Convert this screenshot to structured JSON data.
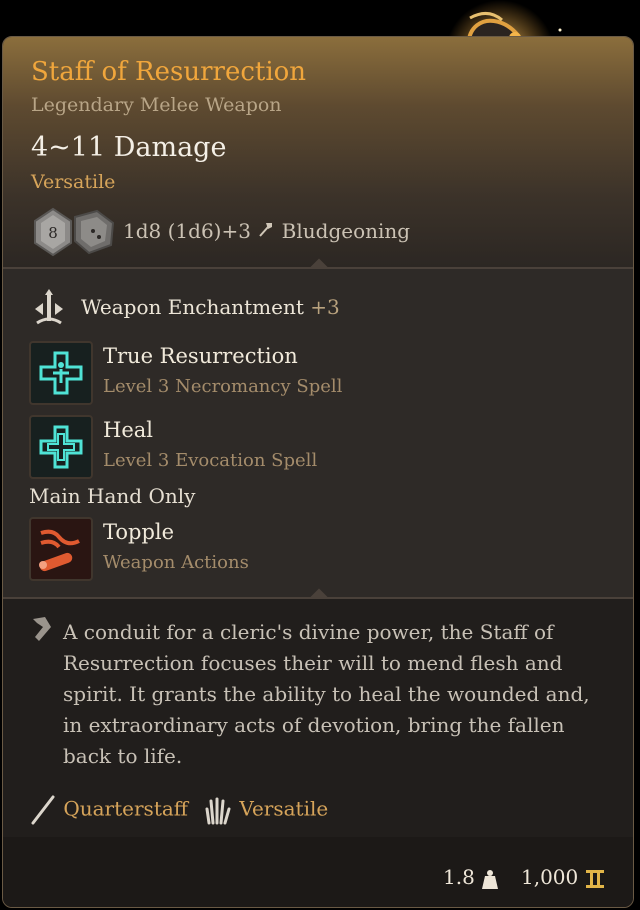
{
  "item": {
    "name": "Staff of Resurrection",
    "rarity_type": "Legendary Melee Weapon",
    "damage": "4~11 Damage",
    "property_tag": "Versatile",
    "dice_face": "8",
    "dice_formula": "1d8 (1d6)+3",
    "damage_type": "Bludgeoning"
  },
  "enchantment": {
    "label": "Weapon Enchantment",
    "bonus": "+3"
  },
  "spells": [
    {
      "name": "True Resurrection",
      "sub": "Level 3 Necromancy Spell"
    },
    {
      "name": "Heal",
      "sub": "Level 3 Evocation Spell"
    }
  ],
  "main_hand_label": "Main Hand Only",
  "action": {
    "name": "Topple",
    "sub": "Weapon Actions"
  },
  "description": "A conduit for a cleric's divine power, the Staff of Resurrection focuses their will to mend flesh and spirit. It grants the ability to heal the wounded and, in extraordinary acts of devotion, bring the fallen back to life.",
  "footer": {
    "weapon_type": "Quarterstaff",
    "property": "Versatile",
    "weight": "1.8",
    "value": "1,000"
  },
  "colors": {
    "legendary": "#f0a63c",
    "property": "#d6a45a",
    "muted": "#a48c6b",
    "card_bg": "#2a2623"
  },
  "icons": [
    "dice-icon",
    "hammer-icon",
    "enchantment-icon",
    "true-resurrection-icon",
    "heal-icon",
    "topple-icon",
    "quill-icon",
    "quarterstaff-icon",
    "versatile-hand-icon",
    "weight-icon",
    "coin-icon"
  ]
}
